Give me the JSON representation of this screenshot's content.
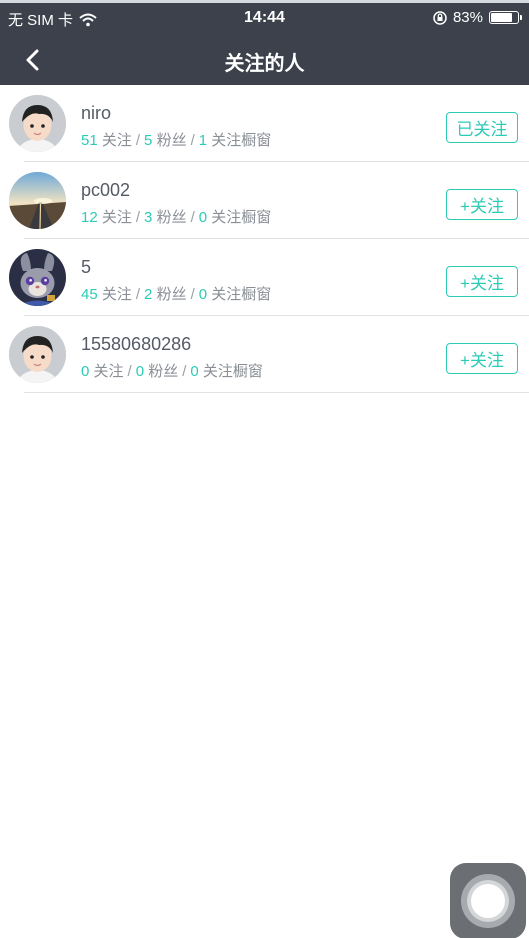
{
  "status_bar": {
    "carrier": "无 SIM 卡",
    "time": "14:44",
    "battery_percent": "83%",
    "battery_level": 0.83
  },
  "header": {
    "title": "关注的人",
    "back_icon": "chevron-left-icon"
  },
  "colors": {
    "header_bg": "#3c414b",
    "accent": "#2ccbb6",
    "text_primary": "#555b66",
    "text_secondary": "#8a8f96"
  },
  "users": [
    {
      "name": "niro",
      "follows": "51",
      "follows_label": "关注",
      "fans": "5",
      "fans_label": "粉丝",
      "windows": "1",
      "windows_label": "关注橱窗",
      "button": "已关注",
      "avatar": "cartoon-boy-avatar"
    },
    {
      "name": "pc002",
      "follows": "12",
      "follows_label": "关注",
      "fans": "3",
      "fans_label": "粉丝",
      "windows": "0",
      "windows_label": "关注橱窗",
      "button": "+关注",
      "avatar": "road-landscape-avatar"
    },
    {
      "name": "5",
      "follows": "45",
      "follows_label": "关注",
      "fans": "2",
      "fans_label": "粉丝",
      "windows": "0",
      "windows_label": "关注橱窗",
      "button": "+关注",
      "avatar": "rabbit-character-avatar"
    },
    {
      "name": "15580680286",
      "follows": "0",
      "follows_label": "关注",
      "fans": "0",
      "fans_label": "粉丝",
      "windows": "0",
      "windows_label": "关注橱窗",
      "button": "+关注",
      "avatar": "cartoon-boy-avatar"
    }
  ],
  "separator": "/"
}
